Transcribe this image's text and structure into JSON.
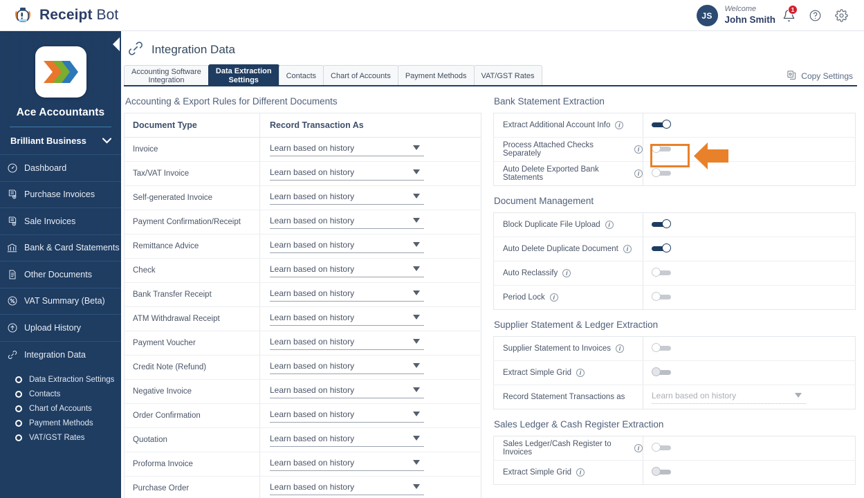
{
  "app": {
    "brand_bold": "Receipt",
    "brand_light": " Bot",
    "logo_icon": "receipt-bot-robot-logo"
  },
  "header": {
    "avatar_initials": "JS",
    "welcome_label": "Welcome",
    "user_name": "John Smith",
    "notification_count": "1",
    "icons": [
      "bell-icon",
      "help-icon",
      "gear-icon"
    ]
  },
  "sidebar": {
    "company_logo_icon": "ace-accountants-chevrons-logo",
    "company_name": "Ace Accountants",
    "org_selector": "Brilliant Business",
    "collapse_icon": "chevron-left-icon",
    "items": [
      {
        "label": "Dashboard",
        "icon": "speedometer-icon"
      },
      {
        "label": "Purchase Invoices",
        "icon": "purchase-invoice-icon"
      },
      {
        "label": "Sale Invoices",
        "icon": "sale-invoice-icon"
      },
      {
        "label": "Bank & Card Statements",
        "icon": "bank-icon"
      },
      {
        "label": "Other Documents",
        "icon": "document-icon"
      },
      {
        "label": "VAT Summary (Beta)",
        "icon": "percent-circle-icon"
      },
      {
        "label": "Upload History",
        "icon": "upload-circle-icon"
      },
      {
        "label": "Integration Data",
        "icon": "link-icon"
      }
    ],
    "sub_items": [
      {
        "label": "Data Extraction Settings"
      },
      {
        "label": "Contacts"
      },
      {
        "label": "Chart of Accounts"
      },
      {
        "label": "Payment Methods"
      },
      {
        "label": "VAT/GST Rates"
      }
    ]
  },
  "page": {
    "title": "Integration Data",
    "title_icon": "link-icon",
    "copy_settings_label": "Copy Settings",
    "copy_settings_icon": "copy-settings-icon"
  },
  "tabs": [
    {
      "label": "Accounting Software\nIntegration",
      "active": false
    },
    {
      "label": "Data Extraction\nSettings",
      "active": true
    },
    {
      "label": "Contacts",
      "active": false
    },
    {
      "label": "Chart of Accounts",
      "active": false
    },
    {
      "label": "Payment Methods",
      "active": false
    },
    {
      "label": "VAT/GST Rates",
      "active": false
    }
  ],
  "left_panel": {
    "section_title": "Accounting & Export Rules for Different Documents",
    "columns": [
      "Document Type",
      "Record Transaction As"
    ],
    "rows": [
      {
        "type": "Invoice",
        "value": "Learn based on history"
      },
      {
        "type": "Tax/VAT Invoice",
        "value": "Learn based on history"
      },
      {
        "type": "Self-generated Invoice",
        "value": "Learn based on history"
      },
      {
        "type": "Payment Confirmation/Receipt",
        "value": "Learn based on history"
      },
      {
        "type": "Remittance Advice",
        "value": "Learn based on history"
      },
      {
        "type": "Check",
        "value": "Learn based on history"
      },
      {
        "type": "Bank Transfer Receipt",
        "value": "Learn based on history"
      },
      {
        "type": "ATM Withdrawal Receipt",
        "value": "Learn based on history"
      },
      {
        "type": "Payment Voucher",
        "value": "Learn based on history"
      },
      {
        "type": "Credit Note (Refund)",
        "value": "Learn based on history"
      },
      {
        "type": "Negative Invoice",
        "value": "Learn based on history"
      },
      {
        "type": "Order Confirmation",
        "value": "Learn based on history"
      },
      {
        "type": "Quotation",
        "value": "Learn based on history"
      },
      {
        "type": "Proforma Invoice",
        "value": "Learn based on history"
      },
      {
        "type": "Purchase Order",
        "value": "Learn based on history"
      }
    ]
  },
  "right_panel": {
    "bank_statement": {
      "title": "Bank Statement Extraction",
      "rows": [
        {
          "label": "Extract Additional Account Info",
          "state": "on",
          "info": "i"
        },
        {
          "label": "Process Attached Checks Separately",
          "state": "off",
          "info": "i",
          "highlighted": true
        },
        {
          "label": "Auto Delete Exported Bank Statements",
          "state": "off",
          "info": "i"
        }
      ]
    },
    "document_management": {
      "title": "Document Management",
      "rows": [
        {
          "label": "Block Duplicate File Upload",
          "state": "on",
          "info": "i"
        },
        {
          "label": "Auto Delete Duplicate Document",
          "state": "on",
          "info": "i"
        },
        {
          "label": "Auto Reclassify",
          "state": "off",
          "info": "i"
        },
        {
          "label": "Period Lock",
          "state": "off",
          "info": "i"
        }
      ]
    },
    "supplier_statement": {
      "title": "Supplier Statement & Ledger Extraction",
      "rows": [
        {
          "label": "Supplier Statement to Invoices",
          "state": "off",
          "info": "i"
        },
        {
          "label": "Extract Simple Grid",
          "state": "off-dim",
          "info": "i"
        }
      ],
      "select_row": {
        "label": "Record Statement Transactions as",
        "value": "Learn based on history",
        "disabled": true
      }
    },
    "sales_ledger": {
      "title": "Sales Ledger & Cash Register Extraction",
      "rows": [
        {
          "label": "Sales Ledger/Cash Register to Invoices",
          "state": "off",
          "info": "i"
        },
        {
          "label": "Extract Simple Grid",
          "state": "off-dim",
          "info": "i"
        }
      ]
    }
  },
  "annotation": {
    "highlight_target": "Process Attached Checks Separately toggle",
    "arrow_color": "#e8812a",
    "highlight_color": "#e8812a"
  },
  "colors": {
    "sidebar_bg": "#1f3c61",
    "accent_navy": "#1f3c61",
    "badge_red": "#d32030",
    "annotation_orange": "#e8812a"
  }
}
